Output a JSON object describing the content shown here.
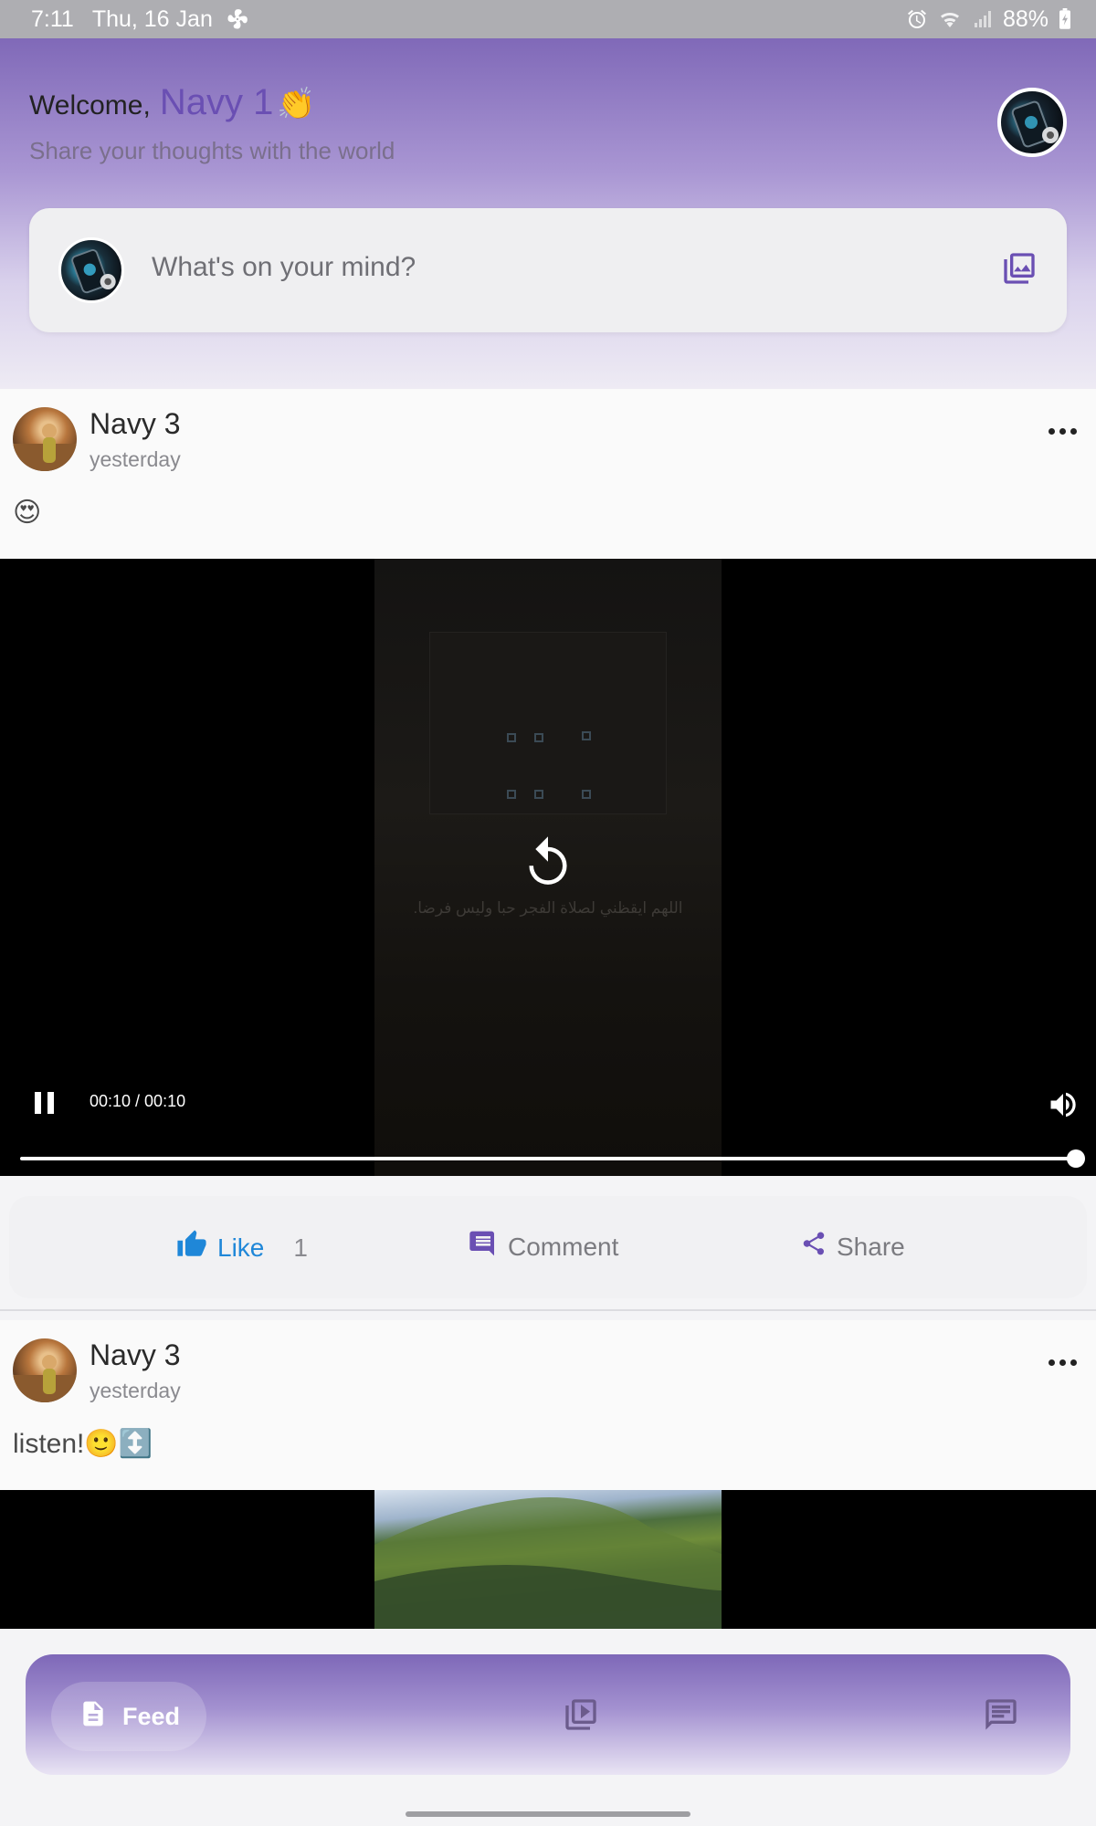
{
  "status_bar": {
    "time": "7:11",
    "date": "Thu, 16 Jan",
    "battery": "88%"
  },
  "header": {
    "welcome_label": "Welcome,",
    "user_name": "Navy 1",
    "wave_emoji": "👏",
    "subtitle": "Share your thoughts with the world"
  },
  "composer": {
    "placeholder": "What's on your mind?"
  },
  "posts": [
    {
      "author": "Navy 3",
      "time": "yesterday",
      "text": "😍",
      "video": {
        "caption": "اللهم ايقظني لصلاة الفجر حبا وليس فرضا.",
        "timecode": "00:10 / 00:10",
        "progress": 1.0
      },
      "actions": {
        "like_label": "Like",
        "like_count": "1",
        "comment_label": "Comment",
        "share_label": "Share"
      }
    },
    {
      "author": "Navy 3",
      "time": "yesterday",
      "text": "listen!🙂↕️"
    }
  ],
  "bottom_nav": {
    "feed_label": "Feed"
  },
  "colors": {
    "accent": "#6a4fb3",
    "like_blue": "#1f87d8",
    "header_top": "#8069b8"
  },
  "icons": [
    "settings-fan-icon",
    "alarm-icon",
    "wifi-icon",
    "signal-icon",
    "battery-icon",
    "image-icon",
    "more-dots-icon",
    "replay-icon",
    "pause-icon",
    "volume-icon",
    "thumb-up-icon",
    "comment-icon",
    "share-icon",
    "feed-icon",
    "video-library-icon",
    "chat-icon"
  ]
}
